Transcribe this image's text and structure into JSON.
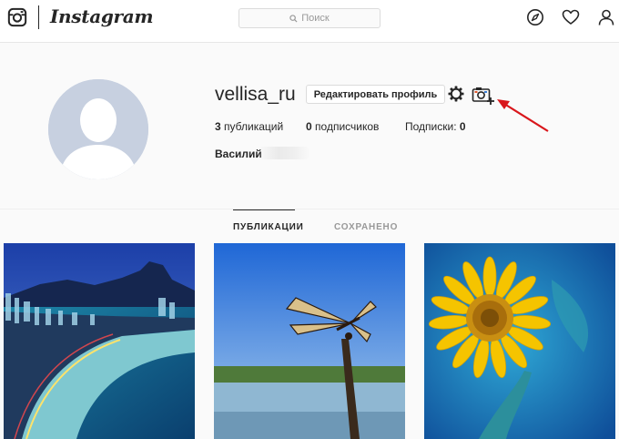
{
  "header": {
    "logo_text": "Instagram",
    "search_placeholder": "Поиск",
    "icons": [
      "instagram-logo-icon",
      "compass-icon",
      "heart-icon",
      "user-icon"
    ]
  },
  "profile": {
    "username": "vellisa_ru",
    "edit_button": "Редактировать профиль",
    "settings_icon": "gear-icon",
    "camera_icon": "add-photo-icon",
    "stats": {
      "posts_count": "3",
      "posts_label": "публикаций",
      "followers_count": "0",
      "followers_label": "подписчиков",
      "following_label": "Подписки:",
      "following_count": "0"
    },
    "full_name": "Василий"
  },
  "tabs": {
    "posts": "ПУБЛИКАЦИИ",
    "saved": "СОХРАНЕНО"
  },
  "posts": [
    {
      "subject": "coastal city at dusk"
    },
    {
      "subject": "dragonfly on a stick"
    },
    {
      "subject": "yellow flower"
    }
  ],
  "colors": {
    "accent_arrow": "#d9161b",
    "text": "#262626",
    "muted": "#999999",
    "avatar_bg": "#c7d0e0"
  }
}
